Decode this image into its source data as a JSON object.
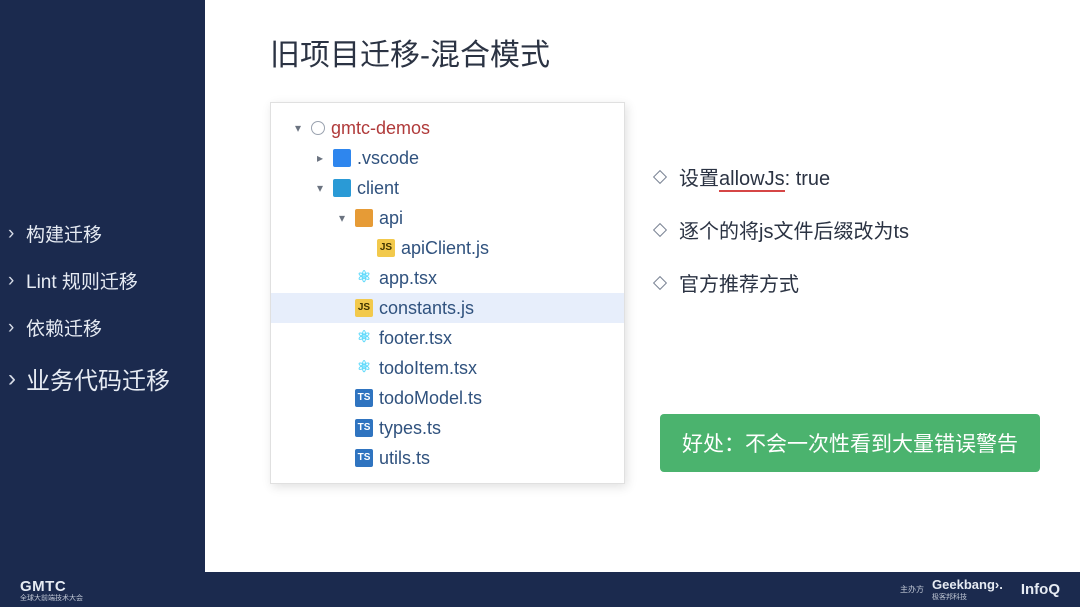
{
  "nav": {
    "items": [
      {
        "label": "构建迁移",
        "active": false
      },
      {
        "label": "Lint 规则迁移",
        "active": false
      },
      {
        "label": "依赖迁移",
        "active": false
      },
      {
        "label": "业务代码迁移",
        "active": true
      }
    ]
  },
  "title": "旧项目迁移-混合模式",
  "tree": [
    {
      "indent": 1,
      "chev": "down",
      "icon": "circle",
      "name": "gmtc-demos",
      "rootColor": true
    },
    {
      "indent": 2,
      "chev": "right",
      "icon": "folder-blue",
      "name": ".vscode"
    },
    {
      "indent": 2,
      "chev": "down",
      "icon": "folder-blue2",
      "name": "client"
    },
    {
      "indent": 3,
      "chev": "down",
      "icon": "folder-orange",
      "name": "api"
    },
    {
      "indent": 4,
      "chev": "none",
      "icon": "js",
      "iconText": "JS",
      "name": "apiClient.js"
    },
    {
      "indent": 3,
      "chev": "none",
      "icon": "react",
      "name": "app.tsx"
    },
    {
      "indent": 3,
      "chev": "none",
      "icon": "js",
      "iconText": "JS",
      "name": "constants.js",
      "selected": true
    },
    {
      "indent": 3,
      "chev": "none",
      "icon": "react",
      "name": "footer.tsx"
    },
    {
      "indent": 3,
      "chev": "none",
      "icon": "react",
      "name": "todoItem.tsx"
    },
    {
      "indent": 3,
      "chev": "none",
      "icon": "ts",
      "iconText": "TS",
      "name": "todoModel.ts"
    },
    {
      "indent": 3,
      "chev": "none",
      "icon": "ts",
      "iconText": "TS",
      "name": "types.ts"
    },
    {
      "indent": 3,
      "chev": "none",
      "icon": "ts",
      "iconText": "TS",
      "name": "utils.ts"
    }
  ],
  "bullets": [
    {
      "pre": "设置",
      "mid": "allowJs",
      "post": ": true",
      "underlineMid": true
    },
    {
      "pre": "逐个的将js文件后缀改为ts"
    },
    {
      "pre": "官方推荐方式"
    }
  ],
  "callout": "好处：不会一次性看到大量错误警告",
  "footer": {
    "brand": "GMTC",
    "brand_sub": "全球大前端技术大会",
    "host_label": "主办方",
    "geek": "Geekbang›.",
    "geek_sub": "极客邦科技",
    "infoq": "InfoQ"
  }
}
